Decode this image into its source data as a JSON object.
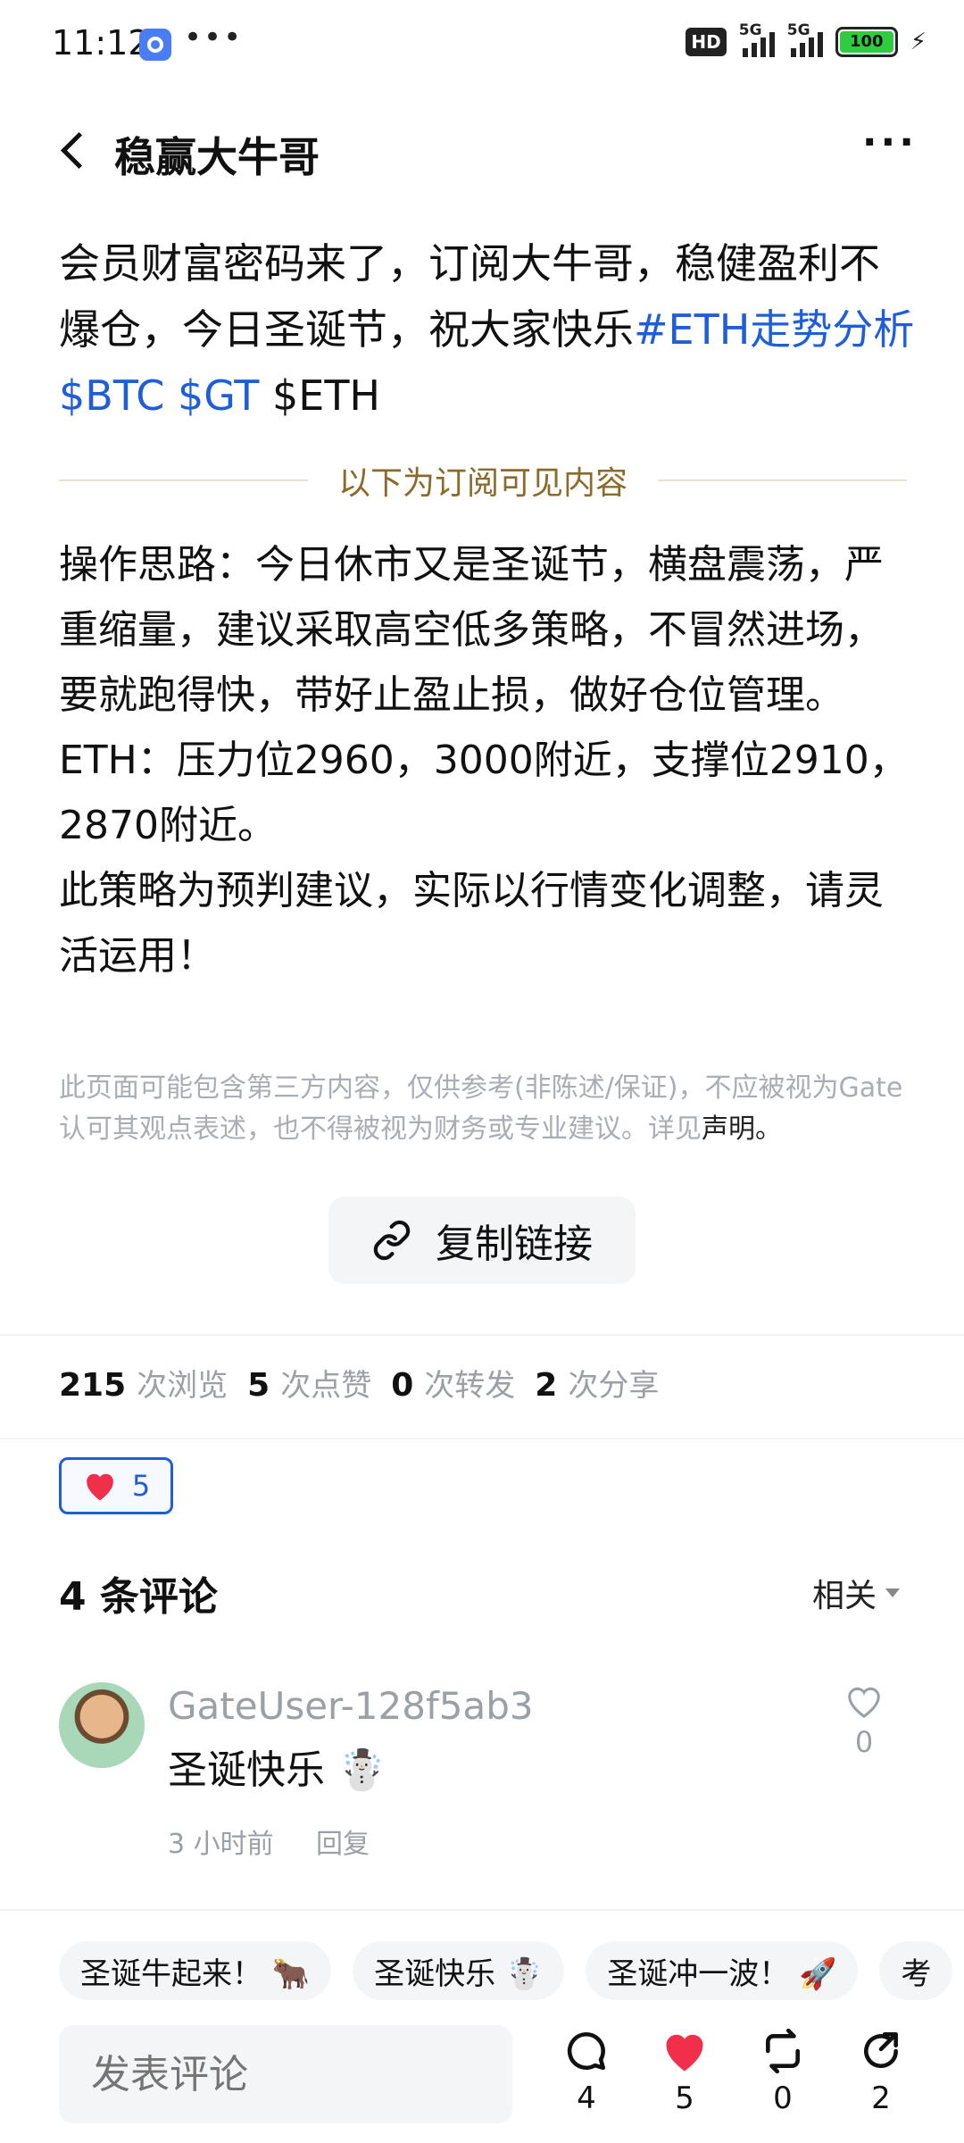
{
  "status_bar": {
    "time": "11:12",
    "dots": "•••",
    "hd": "HD",
    "network_1": "5G",
    "network_2": "5G",
    "battery": "100"
  },
  "header": {
    "title": "稳赢大牛哥",
    "more": "···"
  },
  "post": {
    "text_plain": "会员财富密码来了，订阅大牛哥，稳健盈利不爆仓，今日圣诞节，祝大家快乐",
    "tag_eth": "#ETH走势分析",
    "tag_btc": "$BTC",
    "tag_gt": "$GT",
    "tag_eth2": "$ETH",
    "divider": "以下为订阅可见内容",
    "body": "操作思路：今日休市又是圣诞节，横盘震荡，严重缩量，建议采取高空低多策略，不冒然进场，要就跑得快，带好止盈止损，做好仓位管理。\nETH：压力位2960，3000附近，支撑位2910，2870附近。\n此策略为预判建议，实际以行情变化调整，请灵活运用！",
    "disclaimer": "此页面可能包含第三方内容，仅供参考(非陈述/保证)，不应被视为Gate认可其观点表述，也不得被视为财务或专业建议。详见",
    "disclaimer_link": "声明。",
    "copy_link": "复制链接"
  },
  "stats": {
    "views": "215",
    "views_label": "次浏览",
    "likes": "5",
    "likes_label": "次点赞",
    "reposts": "0",
    "reposts_label": "次转发",
    "shares": "2",
    "shares_label": "次分享"
  },
  "like_chip": {
    "count": "5"
  },
  "comments": {
    "title": "4 条评论",
    "sort": "相关",
    "items": [
      {
        "user": "GateUser-128f5ab3",
        "text": "圣诞快乐 ☃️",
        "time": "3 小时前",
        "reply": "回复",
        "likes": "0"
      }
    ]
  },
  "quick_replies": [
    "圣诞牛起来！ 🐂",
    "圣诞快乐 ☃️",
    "圣诞冲一波！ 🚀",
    "考"
  ],
  "bottom_bar": {
    "placeholder": "发表评论",
    "comments": "4",
    "likes": "5",
    "reposts": "0",
    "shares": "2"
  },
  "colors": {
    "accent": "#1e5fd9",
    "heart": "#f0304a",
    "divider_text": "#8c6a2a"
  }
}
